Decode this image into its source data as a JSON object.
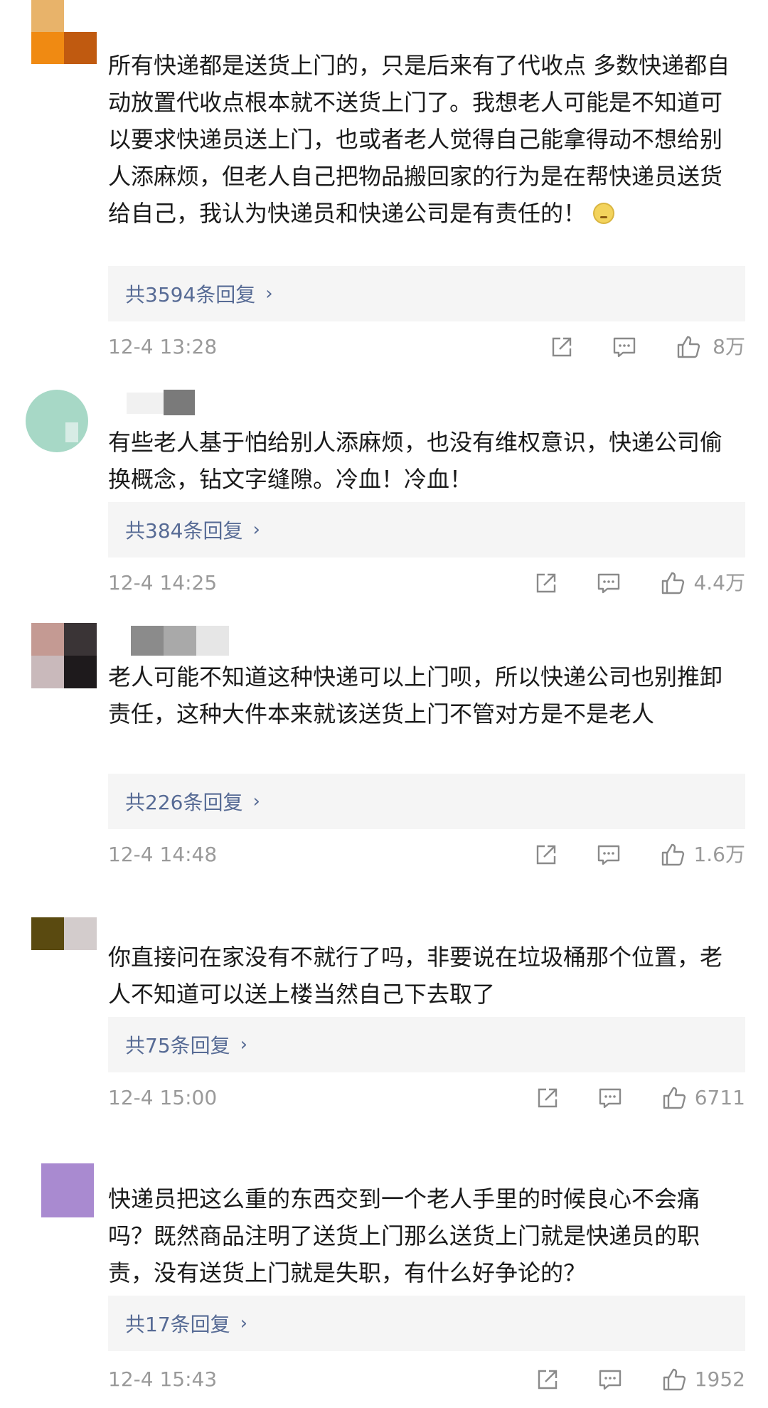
{
  "comments": [
    {
      "text": "所有快递都是送货上门的，只是后来有了代收点 多数快递都自动放置代收点根本就不送货上门了。我想老人可能是不知道可以要求快递员送上门，也或者老人觉得自己能拿得动不想给别人添麻烦，但老人自己把物品搬回家的行为是在帮快递员送货给自己，我认为快递员和快递公司是有责任的！",
      "reply_label": "共3594条回复",
      "time": "12-4 13:28",
      "likes": "8万"
    },
    {
      "text": "有些老人基于怕给别人添麻烦，也没有维权意识，快递公司偷换概念，钻文字缝隙。冷血！冷血！",
      "reply_label": "共384条回复",
      "time": "12-4 14:25",
      "likes": "4.4万"
    },
    {
      "text": "老人可能不知道这种快递可以上门呗，所以快递公司也别推卸责任，这种大件本来就该送货上门不管对方是不是老人",
      "reply_label": "共226条回复",
      "time": "12-4 14:48",
      "likes": "1.6万"
    },
    {
      "text": "你直接问在家没有不就行了吗，非要说在垃圾桶那个位置，老人不知道可以送上楼当然自己下去取了",
      "reply_label": "共75条回复",
      "time": "12-4 15:00",
      "likes": "6711"
    },
    {
      "text": "快递员把这么重的东西交到一个老人手里的时候良心不会痛吗？既然商品注明了送货上门那么送货上门就是快递员的职责，没有送货上门就是失职，有什么好争论的？",
      "reply_label": "共17条回复",
      "time": "12-4 15:43",
      "likes": "1952"
    }
  ],
  "icons": {
    "share": "share-icon",
    "comment": "comment-icon",
    "like": "thumbs-up-icon",
    "chevron": "chevron-right-icon",
    "emoji": "thinking-face-emoji"
  },
  "colors": {
    "reply_link": "#576b95",
    "meta_gray": "#9a9a9a",
    "reply_bg": "#f5f5f5"
  }
}
